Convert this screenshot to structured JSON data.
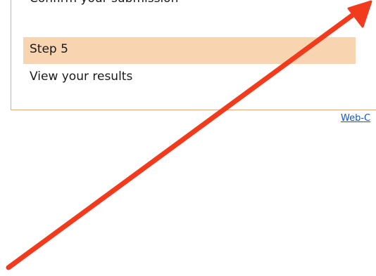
{
  "steps": {
    "partial_label": "Confirm your submission",
    "step5": {
      "heading": "Step 5",
      "description": "View your results"
    }
  },
  "footer": {
    "link_text": "Web-C"
  },
  "colors": {
    "box_border": "#e7a985",
    "heading_highlight": "#f8d4b0",
    "link": "#1155cc",
    "annotation_arrow": "#f23a1d"
  },
  "annotation": {
    "icon": "red-arrow-icon"
  }
}
